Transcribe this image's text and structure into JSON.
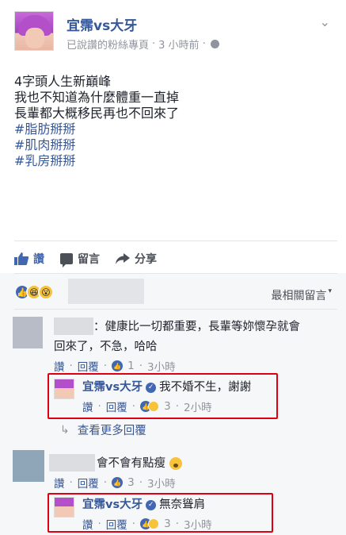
{
  "post": {
    "page_name": "宜霈vs大牙",
    "meta_text": "已說讚的粉絲專頁",
    "meta_sep": "·",
    "time": "3 小時前",
    "lines": [
      "4字頭人生新巔峰",
      "我也不知道為什麼體重一直掉",
      "長輩都大概移民再也不回來了"
    ],
    "hashtags": [
      "#脂肪掰掰",
      "#肌肉掰掰",
      "#乳房掰掰"
    ]
  },
  "actions": {
    "like": "讚",
    "comment": "留言",
    "share": "分享"
  },
  "comments_header": {
    "sort_label": "最相關留言"
  },
  "comments": [
    {
      "text_line1": "：健康比一切都重要，長輩等妳懷孕就會",
      "text_line2": "回來了，不急，哈哈",
      "like_label": "讚",
      "reply_label": "回覆",
      "dot": "·",
      "like_count": "1",
      "time": "3小時",
      "reply": {
        "name": "宜霈vs大牙",
        "text": "我不婚不生，謝謝",
        "like_label": "讚",
        "reply_label": "回覆",
        "dot": "·",
        "like_count": "3",
        "time": "2小時"
      }
    },
    {
      "text_line1": "會不會有點瘦",
      "like_label": "讚",
      "reply_label": "回覆",
      "dot": "·",
      "like_count": "3",
      "time": "3小時",
      "reply": {
        "name": "宜霈vs大牙",
        "text": "無奈聳肩",
        "like_label": "讚",
        "reply_label": "回覆",
        "dot": "·",
        "like_count": "3",
        "time": "3小時"
      }
    }
  ],
  "more_replies": "查看更多回覆",
  "colors": {
    "link": "#365899",
    "facebook_blue": "#4267b2",
    "highlight_box": "#e00012"
  }
}
